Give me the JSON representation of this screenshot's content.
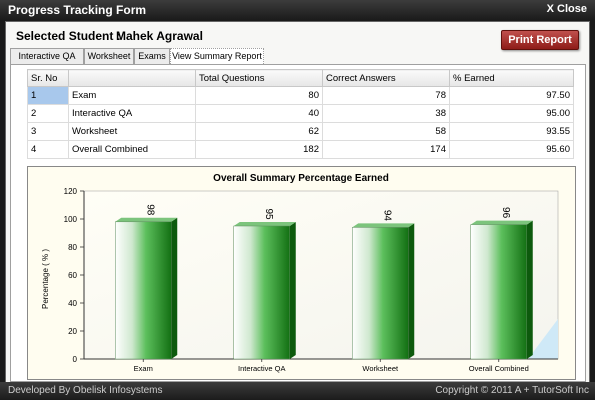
{
  "window": {
    "title": "Progress Tracking Form",
    "close_label": "X Close"
  },
  "student": {
    "label": "Selected Student :",
    "name": "Mahek Agrawal"
  },
  "toolbar": {
    "print_label": "Print Report"
  },
  "tabs": [
    {
      "label": "Interactive QA"
    },
    {
      "label": "Worksheet"
    },
    {
      "label": "Exams"
    },
    {
      "label": "View Summary Report"
    }
  ],
  "table": {
    "headers": [
      "Sr. No",
      "",
      "Total Questions",
      "Correct Answers",
      "% Earned"
    ],
    "rows": [
      [
        "1",
        "Exam",
        "80",
        "78",
        "97.50"
      ],
      [
        "2",
        "Interactive QA",
        "40",
        "38",
        "95.00"
      ],
      [
        "3",
        "Worksheet",
        "62",
        "58",
        "93.55"
      ],
      [
        "4",
        "Overall Combined",
        "182",
        "174",
        "95.60"
      ]
    ]
  },
  "chart_data": {
    "type": "bar",
    "title": "Overall Summary Percentage Earned",
    "ylabel": "Percentage ( % )",
    "xlabel": "",
    "categories": [
      "Exam",
      "Interactive QA",
      "Worksheet",
      "Overall Combined"
    ],
    "values": [
      98,
      95,
      94,
      96
    ],
    "ylim": [
      0,
      120
    ],
    "yticks": [
      0,
      20,
      40,
      60,
      80,
      100,
      120
    ],
    "grid": false,
    "colors": {
      "bar_dark": "#1a7a1a",
      "bar_light": "#ffffff",
      "background": "#fffdf0"
    }
  },
  "footer": {
    "left": "Developed By Obelisk Infosystems",
    "right": "Copyright © 2011  A + TutorSoft Inc"
  }
}
